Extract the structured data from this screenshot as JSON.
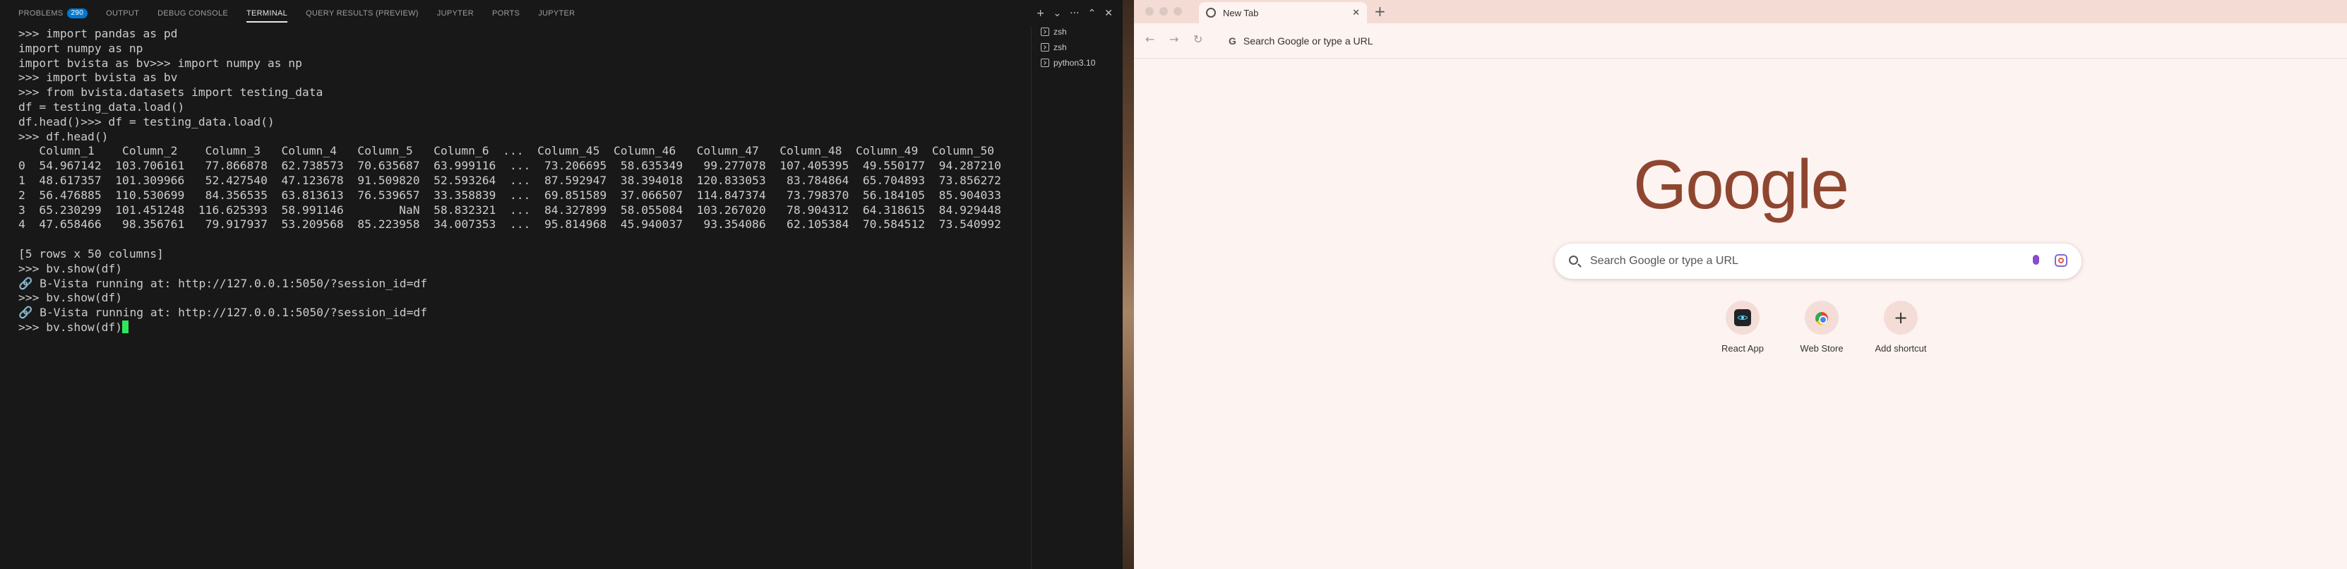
{
  "vscode": {
    "panel_tabs": [
      {
        "label": "PROBLEMS",
        "badge": "290"
      },
      {
        "label": "OUTPUT"
      },
      {
        "label": "DEBUG CONSOLE"
      },
      {
        "label": "TERMINAL",
        "active": true
      },
      {
        "label": "QUERY RESULTS (PREVIEW)"
      },
      {
        "label": "JUPYTER"
      },
      {
        "label": "PORTS"
      },
      {
        "label": "JUPYTER"
      }
    ],
    "panel_actions": {
      "add": "+",
      "dropdown": "⌄",
      "more": "···",
      "maximize": "⌃",
      "close": "✕"
    },
    "terminal_lines": [
      ">>> import pandas as pd",
      "import numpy as np",
      "import bvista as bv>>> import numpy as np",
      ">>> import bvista as bv",
      ">>> from bvista.datasets import testing_data",
      "df = testing_data.load()",
      "df.head()>>> df = testing_data.load()",
      ">>> df.head()",
      "   Column_1    Column_2    Column_3   Column_4   Column_5   Column_6  ...  Column_45  Column_46   Column_47   Column_48  Column_49  Column_50",
      "0  54.967142  103.706161   77.866878  62.738573  70.635687  63.999116  ...  73.206695  58.635349   99.277078  107.405395  49.550177  94.287210",
      "1  48.617357  101.309966   52.427540  47.123678  91.509820  52.593264  ...  87.592947  38.394018  120.833053   83.784864  65.704893  73.856272",
      "2  56.476885  110.530699   84.356535  63.813613  76.539657  33.358839  ...  69.851589  37.066507  114.847374   73.798370  56.184105  85.904033",
      "3  65.230299  101.451248  116.625393  58.991146        NaN  58.832321  ...  84.327899  58.055084  103.267020   78.904312  64.318615  84.929448",
      "4  47.658466   98.356761   79.917937  53.209568  85.223958  34.007353  ...  95.814968  45.940037   93.354086   62.105384  70.584512  73.540992",
      "",
      "[5 rows x 50 columns]",
      ">>> bv.show(df)",
      "🔗 B-Vista running at: http://127.0.0.1:5050/?session_id=df",
      ">>> bv.show(df)",
      "🔗 B-Vista running at: http://127.0.0.1:5050/?session_id=df"
    ],
    "prompt_line": ">>> bv.show(df)",
    "terminal_list": [
      "zsh",
      "zsh",
      "python3.10"
    ]
  },
  "chrome": {
    "tab_title": "New Tab",
    "tab_close": "✕",
    "new_tab": "+",
    "nav": {
      "back": "←",
      "forward": "→",
      "reload": "↻"
    },
    "omnibox_placeholder": "Search Google or type a URL",
    "omnibox_g": "G",
    "logo": "Google",
    "search_placeholder": "Search Google or type a URL",
    "shortcuts": [
      {
        "label": "React App",
        "icon": "react-icon"
      },
      {
        "label": "Web Store",
        "icon": "web-store-icon"
      },
      {
        "label": "Add shortcut",
        "icon": "plus-icon",
        "glyph": "+"
      }
    ],
    "colors": {
      "logo": "#8e4630",
      "page_bg": "#fdf3f0",
      "tabstrip_bg": "#f4dcd5",
      "terminal_bg": "#181818",
      "cursor": "#2ee65c"
    }
  }
}
